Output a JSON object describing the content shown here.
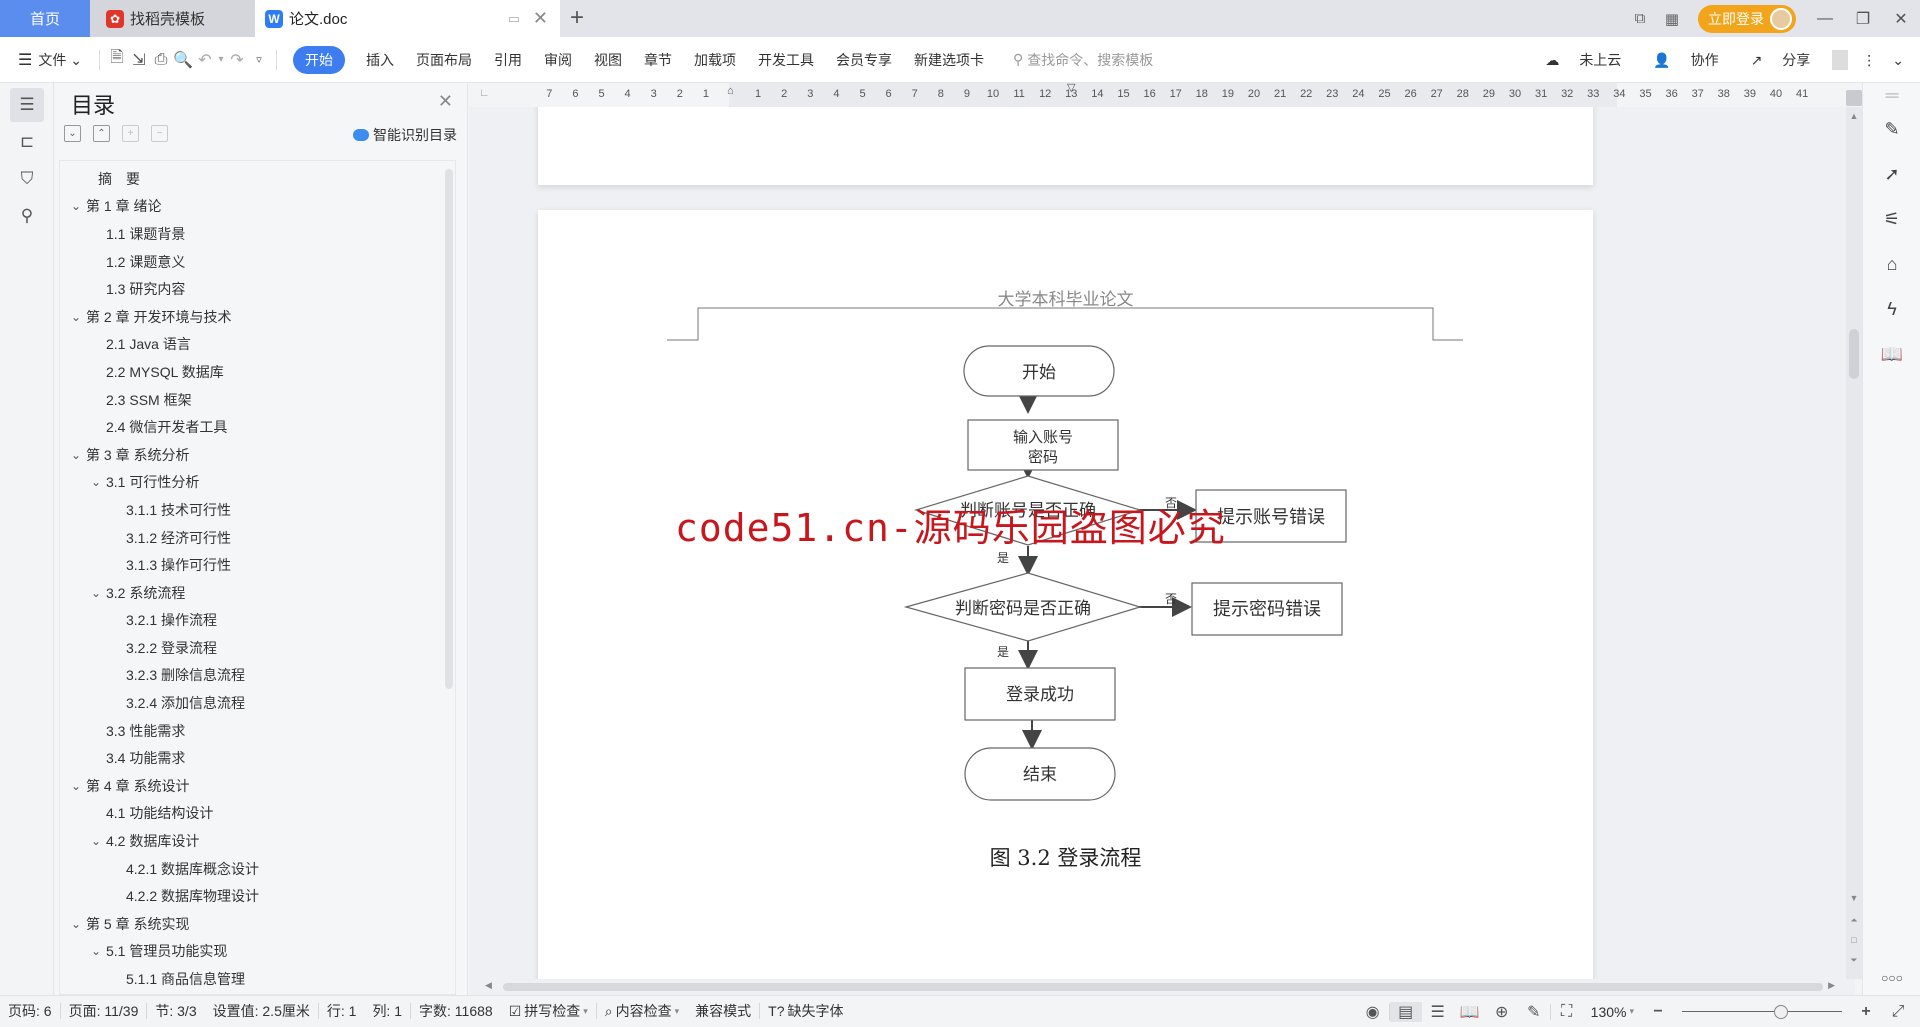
{
  "tabs": {
    "home": "首页",
    "template": "找稻壳模板",
    "document": "论文.doc"
  },
  "titlebar": {
    "login": "立即登录"
  },
  "ribbon": {
    "file": "文件",
    "tabs": [
      "开始",
      "插入",
      "页面布局",
      "引用",
      "审阅",
      "视图",
      "章节",
      "加载项",
      "开发工具",
      "会员专享",
      "新建选项卡"
    ],
    "active_tab": "开始",
    "search_placeholder": "查找命令、搜索模板",
    "cloud": "未上云",
    "collab": "协作",
    "share": "分享"
  },
  "toc": {
    "title": "目录",
    "smart_label": "智能识别目录",
    "items": [
      {
        "label": "摘　要",
        "level": 0,
        "chev": false
      },
      {
        "label": "第 1 章  绪论",
        "level": 0,
        "chev": true
      },
      {
        "label": "1.1  课题背景",
        "level": 1,
        "chev": false
      },
      {
        "label": "1.2  课题意义",
        "level": 1,
        "chev": false
      },
      {
        "label": "1.3  研究内容",
        "level": 1,
        "chev": false
      },
      {
        "label": "第 2 章  开发环境与技术",
        "level": 0,
        "chev": true
      },
      {
        "label": "2.1 Java 语言",
        "level": 1,
        "chev": false
      },
      {
        "label": "2.2 MYSQL 数据库",
        "level": 1,
        "chev": false
      },
      {
        "label": "2.3 SSM 框架",
        "level": 1,
        "chev": false
      },
      {
        "label": "2.4 微信开发者工具",
        "level": 1,
        "chev": false
      },
      {
        "label": "第 3 章  系统分析",
        "level": 0,
        "chev": true
      },
      {
        "label": "3.1  可行性分析",
        "level": 1,
        "chev": true
      },
      {
        "label": "3.1.1  技术可行性",
        "level": 2,
        "chev": false
      },
      {
        "label": "3.1.2  经济可行性",
        "level": 2,
        "chev": false
      },
      {
        "label": "3.1.3  操作可行性",
        "level": 2,
        "chev": false
      },
      {
        "label": "3.2  系统流程",
        "level": 1,
        "chev": true
      },
      {
        "label": "3.2.1  操作流程",
        "level": 2,
        "chev": false
      },
      {
        "label": "3.2.2  登录流程",
        "level": 2,
        "chev": false
      },
      {
        "label": "3.2.3  删除信息流程",
        "level": 2,
        "chev": false
      },
      {
        "label": "3.2.4  添加信息流程",
        "level": 2,
        "chev": false
      },
      {
        "label": "3.3  性能需求",
        "level": 1,
        "chev": false
      },
      {
        "label": "3.4  功能需求",
        "level": 1,
        "chev": false
      },
      {
        "label": "第 4 章  系统设计",
        "level": 0,
        "chev": true
      },
      {
        "label": "4.1  功能结构设计",
        "level": 1,
        "chev": false
      },
      {
        "label": "4.2  数据库设计",
        "level": 1,
        "chev": true
      },
      {
        "label": "4.2.1  数据库概念设计",
        "level": 2,
        "chev": false
      },
      {
        "label": "4.2.2  数据库物理设计",
        "level": 2,
        "chev": false
      },
      {
        "label": "第 5 章  系统实现",
        "level": 0,
        "chev": true
      },
      {
        "label": "5.1  管理员功能实现",
        "level": 1,
        "chev": true
      },
      {
        "label": "5.1.1  商品信息管理",
        "level": 2,
        "chev": false
      }
    ]
  },
  "ruler": {
    "left": [
      "7",
      "6",
      "5",
      "4",
      "3",
      "2",
      "1"
    ],
    "right": [
      "1",
      "2",
      "3",
      "4",
      "5",
      "6",
      "7",
      "8",
      "9",
      "10",
      "11",
      "12",
      "13",
      "14",
      "15",
      "16",
      "17",
      "18",
      "19",
      "20",
      "21",
      "22",
      "23",
      "24",
      "25",
      "26",
      "27",
      "28",
      "29",
      "30",
      "31",
      "32",
      "33",
      "34",
      "35",
      "36",
      "37",
      "38",
      "39",
      "40",
      "41"
    ]
  },
  "document": {
    "header": "大学本科毕业论文",
    "flowchart": {
      "start": "开始",
      "input": "输入账号\n密码",
      "check_account": "判断账号是否正确",
      "account_error": "提示账号错误",
      "check_password": "判断密码是否正确",
      "password_error": "提示密码错误",
      "success": "登录成功",
      "end": "结束",
      "yes": "是",
      "no": "否"
    },
    "caption": "图 3.2  登录流程",
    "watermark": "code51.cn-源码乐园盗图必究"
  },
  "status": {
    "page_num": "页码: 6",
    "page": "页面: 11/39",
    "section": "节: 3/3",
    "setting": "设置值: 2.5厘米",
    "row": "行: 1",
    "col": "列: 1",
    "words": "字数: 11688",
    "spell": "拼写检查",
    "content_check": "内容检查",
    "compat": "兼容模式",
    "missing_font": "缺失字体",
    "zoom": "130%",
    "zoom_fraction": 0.62
  }
}
